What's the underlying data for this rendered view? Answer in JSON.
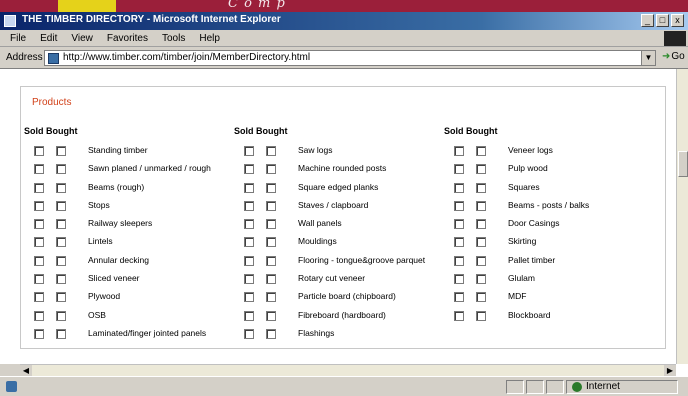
{
  "banner": {
    "text": "C o m p"
  },
  "window": {
    "title": "THE TIMBER DIRECTORY - Microsoft Internet Explorer",
    "buttons": [
      "_",
      "□",
      "x"
    ]
  },
  "menu": [
    "File",
    "Edit",
    "View",
    "Favorites",
    "Tools",
    "Help"
  ],
  "address": {
    "label": "Address",
    "url": "http://www.timber.com/timber/join/MemberDirectory.html",
    "go_label": "Go"
  },
  "section_title": "Products",
  "columns": [
    {
      "header": "Sold Bought",
      "items": [
        "Standing timber",
        "Sawn planed / unmarked / rough",
        "Beams (rough)",
        "Stops",
        "Railway sleepers",
        "Lintels",
        "Annular decking",
        "Sliced veneer",
        "Plywood",
        "OSB",
        "Laminated/finger jointed panels"
      ]
    },
    {
      "header": "Sold Bought",
      "items": [
        "Saw logs",
        "Machine rounded posts",
        "Square edged planks",
        "Staves / clapboard",
        "Wall panels",
        "Mouldings",
        "Flooring - tongue&groove parquet",
        "Rotary cut veneer",
        "Particle board (chipboard)",
        "Fibreboard (hardboard)",
        "Flashings"
      ]
    },
    {
      "header": "Sold Bought",
      "items": [
        "Veneer logs",
        "Pulp wood",
        "Squares",
        "Beams - posts / balks",
        "Door Casings",
        "Skirting",
        "Pallet timber",
        "Glulam",
        "MDF",
        "Blockboard"
      ]
    }
  ],
  "status": {
    "zone": "Internet"
  }
}
